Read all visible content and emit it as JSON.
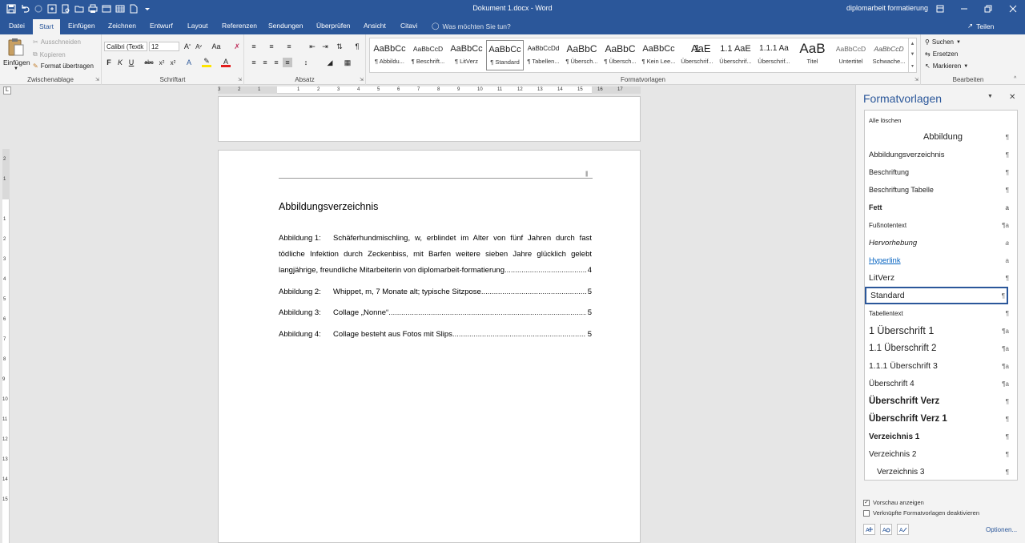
{
  "window": {
    "title": "Dokument 1.docx - Word",
    "user": "diplomarbeit formatierung"
  },
  "tabs": [
    "Datei",
    "Start",
    "Einfügen",
    "Zeichnen",
    "Entwurf",
    "Layout",
    "Referenzen",
    "Sendungen",
    "Überprüfen",
    "Ansicht",
    "Citavi"
  ],
  "tell_me": "Was möchten Sie tun?",
  "share": "Teilen",
  "clipboard": {
    "paste": "Einfügen",
    "cut": "Ausschneiden",
    "copy": "Kopieren",
    "format_painter": "Format übertragen",
    "group": "Zwischenablage"
  },
  "font": {
    "name": "Calibri (Textk",
    "size": "12",
    "group": "Schriftart"
  },
  "paragraph": {
    "group": "Absatz"
  },
  "styles": {
    "group": "Formatvorlagen",
    "items": [
      {
        "preview": "AaBbCc",
        "name": "¶ Abbildu..."
      },
      {
        "preview": "AaBbCcD",
        "name": "¶ Beschrift..."
      },
      {
        "preview": "AaBbCc",
        "name": "¶ LitVerz"
      },
      {
        "preview": "AaBbCc",
        "name": "¶ Standard"
      },
      {
        "preview": "AaBbCcDd",
        "name": "¶ Tabellen..."
      },
      {
        "preview": "AaBbC",
        "name": "¶ Übersch..."
      },
      {
        "preview": "AaBbC",
        "name": "¶ Übersch..."
      },
      {
        "preview": "AaBbCc",
        "name": "¶ Kein Lee..."
      },
      {
        "preview": "1",
        "name": "Überschrif..."
      },
      {
        "preview": "AaE",
        "name": ""
      },
      {
        "preview": "1.1 AaE",
        "name": "Überschrif..."
      },
      {
        "preview": "1.1.1 Aa",
        "name": "Überschrif..."
      },
      {
        "preview": "AaB",
        "name": "Titel"
      },
      {
        "preview": "AaBbCcD",
        "name": "Untertitel"
      },
      {
        "preview": "AaBbCcD",
        "name": "Schwache..."
      }
    ]
  },
  "editing": {
    "find": "Suchen",
    "replace": "Ersetzen",
    "select": "Markieren",
    "group": "Bearbeiten"
  },
  "ruler": {
    "h_ticks": [
      "3",
      "2",
      "1",
      "1",
      "2",
      "3",
      "4",
      "5",
      "6",
      "7",
      "8",
      "9",
      "10",
      "11",
      "12",
      "13",
      "14",
      "15",
      "16",
      "17"
    ],
    "v_ticks": [
      "2",
      "1",
      "1",
      "2",
      "3",
      "4",
      "5",
      "6",
      "7",
      "8",
      "9",
      "10",
      "11",
      "12",
      "13",
      "14",
      "15"
    ]
  },
  "document": {
    "heading": "Abbildungsverzeichnis",
    "entries": [
      {
        "label": "Abbildung 1:",
        "line1": "Schäferhundmischling, w, erblindet im Alter von fünf Jahren durch fast",
        "line2": "tödliche Infektion durch Zeckenbiss, mit Barfen weitere sieben Jahre glücklich gelebt",
        "text": "langjährige, freundliche Mitarbeiterin von diplomarbeit-formatierung",
        "page": "4"
      },
      {
        "label": "Abbildung 2:",
        "text": "Whippet, m, 7 Monate alt; typische Sitzpose",
        "page": "5"
      },
      {
        "label": "Abbildung 3:",
        "text": "Collage „Nonne“",
        "page": "5"
      },
      {
        "label": "Abbildung 4:",
        "text": "Collage besteht aus Fotos mit Slips",
        "page": "5"
      }
    ]
  },
  "pane": {
    "title": "Formatvorlagen",
    "clear_all": "Alle löschen",
    "styles": [
      {
        "name": "Abbildung",
        "mark": "¶"
      },
      {
        "name": "Abbildungsverzeichnis",
        "mark": "¶"
      },
      {
        "name": "Beschriftung",
        "mark": "¶"
      },
      {
        "name": "Beschriftung Tabelle",
        "mark": "¶"
      },
      {
        "name": "Fett",
        "mark": "a"
      },
      {
        "name": "Fußnotentext",
        "mark": "¶a"
      },
      {
        "name": "Hervorhebung",
        "mark": "a"
      },
      {
        "name": "Hyperlink",
        "mark": "a"
      },
      {
        "name": "LitVerz",
        "mark": "¶"
      },
      {
        "name": "Standard",
        "mark": "¶"
      },
      {
        "name": "Tabellentext",
        "mark": "¶"
      },
      {
        "name": "1  Überschrift 1",
        "mark": "¶a"
      },
      {
        "name": "1.1  Überschrift 2",
        "mark": "¶a"
      },
      {
        "name": "1.1.1  Überschrift 3",
        "mark": "¶a"
      },
      {
        "name": "Überschrift 4",
        "mark": "¶a"
      },
      {
        "name": "Überschrift Verz",
        "mark": "¶"
      },
      {
        "name": "Überschrift Verz 1",
        "mark": "¶"
      },
      {
        "name": "Verzeichnis 1",
        "mark": "¶"
      },
      {
        "name": "Verzeichnis 2",
        "mark": "¶"
      },
      {
        "name": "Verzeichnis 3",
        "mark": "¶"
      }
    ],
    "show_preview": "Vorschau anzeigen",
    "disable_linked": "Verknüpfte Formatvorlagen deaktivieren",
    "options": "Optionen..."
  },
  "colors": {
    "accent": "#2b579a",
    "font_color": "#e21c1c",
    "highlight": "#ffe500"
  }
}
